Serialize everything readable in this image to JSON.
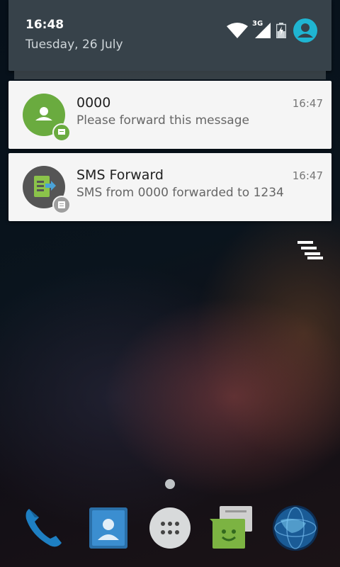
{
  "status": {
    "time": "16:48",
    "date": "Tuesday, 26 July",
    "network_type": "3G",
    "icons": [
      "wifi-icon",
      "cell-signal-icon",
      "battery-charging-icon",
      "user-avatar-icon"
    ],
    "accent": "#1fb5d2"
  },
  "notifications": [
    {
      "title": "0000",
      "text": "Please forward this message",
      "time": "16:47",
      "icon": "contact-icon",
      "badge": "message-icon",
      "color": "#6aab3f"
    },
    {
      "title": "SMS Forward",
      "text": "SMS from 0000 forwarded to 1234",
      "time": "16:47",
      "icon": "sms-forward-app-icon",
      "badge": "message-icon",
      "color": "#555555"
    }
  ],
  "actions": {
    "clear_all_icon": "clear-all-icon"
  },
  "dock": [
    {
      "name": "phone",
      "icon": "phone-icon"
    },
    {
      "name": "contacts",
      "icon": "contacts-icon"
    },
    {
      "name": "apps",
      "icon": "app-drawer-icon"
    },
    {
      "name": "messaging",
      "icon": "messaging-icon"
    },
    {
      "name": "browser",
      "icon": "browser-globe-icon"
    }
  ]
}
